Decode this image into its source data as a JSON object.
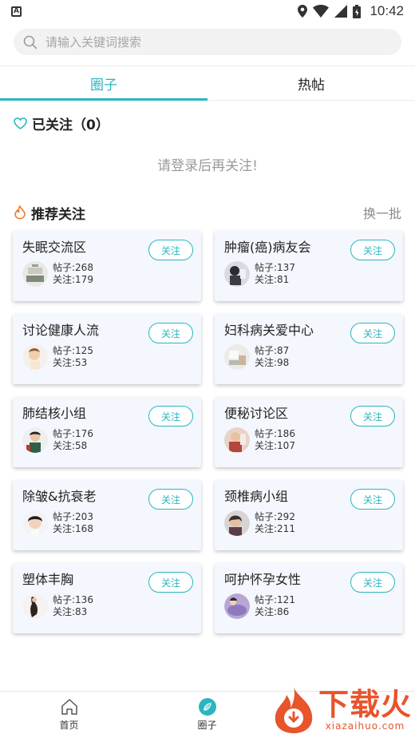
{
  "status_bar": {
    "time": "10:42"
  },
  "search": {
    "placeholder": "请输入关键词搜索"
  },
  "tabs": [
    {
      "label": "圈子",
      "active": true
    },
    {
      "label": "热帖",
      "active": false
    }
  ],
  "followed": {
    "title": "已关注（0）",
    "login_tip": "请登录后再关注!"
  },
  "recommend": {
    "title": "推荐关注",
    "change_label": "换一批"
  },
  "groups": [
    {
      "name": "失眠交流区",
      "posts": "帖子:268",
      "follows": "关注:179",
      "follow_label": "关注"
    },
    {
      "name": "肿瘤(癌)病友会",
      "posts": "帖子:137",
      "follows": "关注:81",
      "follow_label": "关注"
    },
    {
      "name": "讨论健康人流",
      "posts": "帖子:125",
      "follows": "关注:53",
      "follow_label": "关注"
    },
    {
      "name": "妇科病关爱中心",
      "posts": "帖子:87",
      "follows": "关注:98",
      "follow_label": "关注"
    },
    {
      "name": "肺结核小组",
      "posts": "帖子:176",
      "follows": "关注:58",
      "follow_label": "关注"
    },
    {
      "name": "便秘讨论区",
      "posts": "帖子:186",
      "follows": "关注:107",
      "follow_label": "关注"
    },
    {
      "name": "除皱&抗衰老",
      "posts": "帖子:203",
      "follows": "关注:168",
      "follow_label": "关注"
    },
    {
      "name": "颈椎病小组",
      "posts": "帖子:292",
      "follows": "关注:211",
      "follow_label": "关注"
    },
    {
      "name": "塑体丰胸",
      "posts": "帖子:136",
      "follows": "关注:83",
      "follow_label": "关注"
    },
    {
      "name": "呵护怀孕女性",
      "posts": "帖子:121",
      "follows": "关注:86",
      "follow_label": "关注"
    }
  ],
  "bottom_nav": [
    {
      "label": "首页",
      "icon": "home-icon"
    },
    {
      "label": "圈子",
      "icon": "leaf-icon"
    }
  ],
  "watermark": {
    "brand": "下载火",
    "domain": "xiazaihuo.com"
  },
  "colors": {
    "accent": "#2bb6bf",
    "watermark": "#e8542c",
    "card_bg": "#f4f7fd"
  }
}
